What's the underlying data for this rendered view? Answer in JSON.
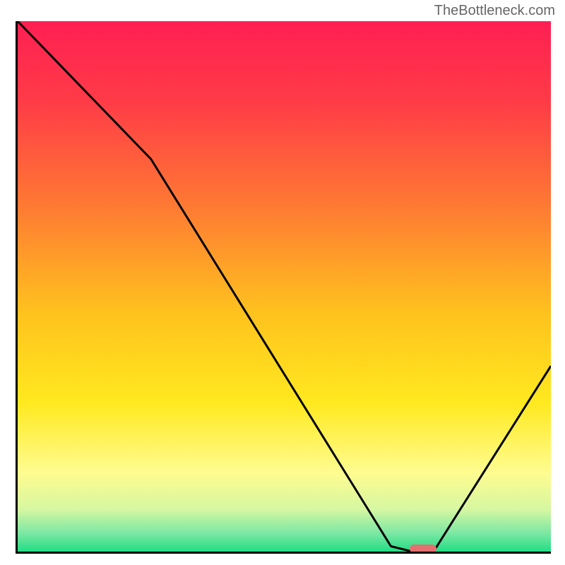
{
  "watermark": "TheBottleneck.com",
  "chart_data": {
    "type": "line",
    "title": "",
    "xlabel": "",
    "ylabel": "",
    "xlim": [
      0,
      100
    ],
    "ylim": [
      0,
      100
    ],
    "x": [
      0,
      25,
      70,
      74,
      78,
      100
    ],
    "values": [
      100,
      74,
      1,
      0,
      0,
      35
    ],
    "marker": {
      "x": 76,
      "y": 0,
      "width_pct": 5
    },
    "gradient_stops": [
      {
        "pos": 0.0,
        "color": "#ff1f53"
      },
      {
        "pos": 0.15,
        "color": "#ff3b47"
      },
      {
        "pos": 0.35,
        "color": "#ff7a33"
      },
      {
        "pos": 0.55,
        "color": "#ffc21e"
      },
      {
        "pos": 0.72,
        "color": "#ffe91f"
      },
      {
        "pos": 0.85,
        "color": "#fffc8f"
      },
      {
        "pos": 0.92,
        "color": "#d7f7a1"
      },
      {
        "pos": 0.965,
        "color": "#7ce8a4"
      },
      {
        "pos": 1.0,
        "color": "#23dd85"
      }
    ]
  },
  "colors": {
    "axis": "#000000",
    "curve": "#000000",
    "marker": "#e4706f",
    "watermark": "#666666"
  }
}
